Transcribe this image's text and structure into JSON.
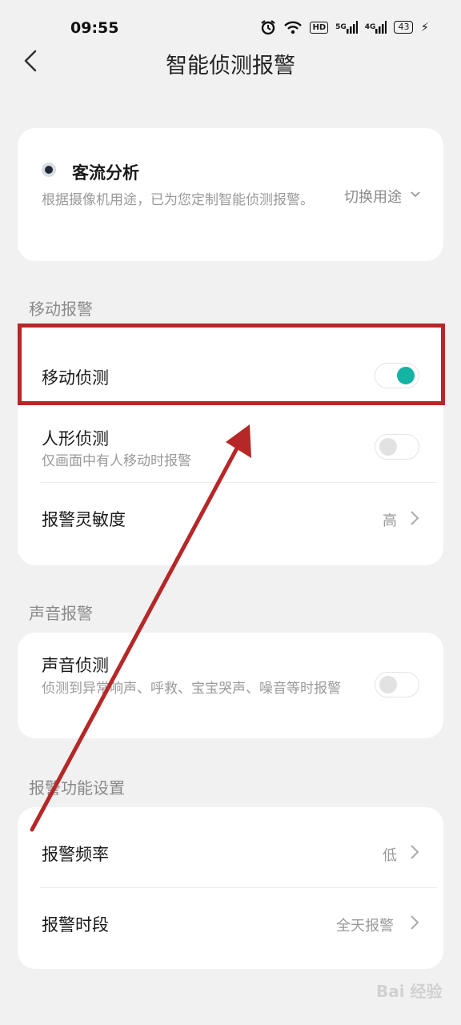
{
  "status": {
    "time": "09:55",
    "hd": "HD",
    "sig1": "5G",
    "sig2": "4G",
    "battery": "43"
  },
  "header": {
    "title": "智能侦测报警"
  },
  "usage": {
    "name": "客流分析",
    "description": "根据摄像机用途，已为您定制智能侦测报警。",
    "switch_label": "切换用途"
  },
  "sections": {
    "motion": {
      "title": "移动报警",
      "motion_detect": {
        "label": "移动侦测",
        "on": true
      },
      "human_detect": {
        "label": "人形侦测",
        "sub": "仅画面中有人移动时报警",
        "on": false
      },
      "sensitivity": {
        "label": "报警灵敏度",
        "value": "高"
      }
    },
    "sound": {
      "title": "声音报警",
      "sound_detect": {
        "label": "声音侦测",
        "sub": "侦测到异常响声、呼救、宝宝哭声、噪音等时报警",
        "on": false
      }
    },
    "settings": {
      "title": "报警功能设置",
      "frequency": {
        "label": "报警频率",
        "value": "低"
      },
      "period": {
        "label": "报警时段",
        "value": "全天报警"
      }
    }
  },
  "watermark": "Bai 经验",
  "colors": {
    "accent": "#14b3a4",
    "annotation": "#b62727"
  }
}
